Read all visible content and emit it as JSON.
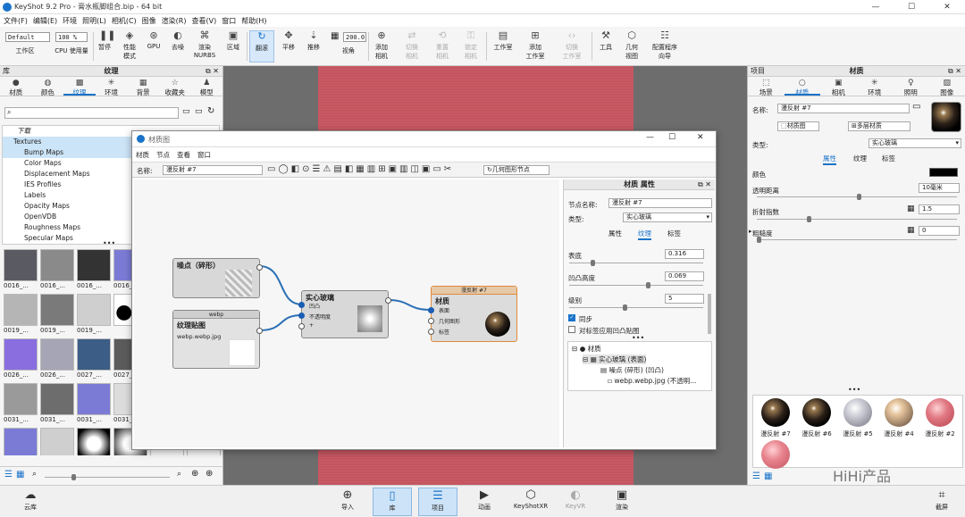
{
  "app": {
    "title": "KeyShot 9.2 Pro - 膏水瓶脚组合.bip - 64 bit",
    "min": "—",
    "max": "☐",
    "close": "✕"
  },
  "menu": [
    "文件(F)",
    "编辑(E)",
    "环境",
    "照明(L)",
    "相机(C)",
    "图像",
    "渲染(R)",
    "查看(V)",
    "窗口",
    "帮助(H)"
  ],
  "toolbar": {
    "workspace_value": "Default",
    "workspace_label": "工作区",
    "cpu_value": "100 %",
    "cpu_label": "CPU 使用量",
    "pause": "暂停",
    "perf": "性能\n模式",
    "gpu": "GPU",
    "denoise": "去噪",
    "nurbs": "渲染\nNURBS",
    "region": "区域",
    "tumble": "翻滚",
    "pan": "平移",
    "dolly": "推移",
    "fov_value": "200.0",
    "view": "视角",
    "add_cam": "添加\n相机",
    "switch_cam": "切换\n相机",
    "reset_cam": "重置\n相机",
    "lock_cam": "锁定\n相机",
    "workspace": "工作室",
    "add_ws": "添加\n工作室",
    "switch_ws": "切换\n工作室",
    "tools": "工具",
    "geo_view": "几何\n视图",
    "config": "配置程序\n向导"
  },
  "library": {
    "title": "库",
    "panel_title": "纹理",
    "tabs": [
      "材质",
      "颜色",
      "纹理",
      "环境",
      "背景",
      "收藏夹",
      "模型"
    ],
    "tree_top": "下载",
    "tree_root": "Textures",
    "tree": [
      "Bump Maps",
      "Color Maps",
      "Displacement Maps",
      "IES Profiles",
      "Labels",
      "Opacity Maps",
      "OpenVDB",
      "Roughness Maps",
      "Specular Maps"
    ],
    "thumbs": [
      "0016_...",
      "0016_...",
      "0016_...",
      "0016_...",
      "",
      "",
      "0019_...",
      "0019_...",
      "0019_...",
      "",
      "",
      "",
      "0026_...",
      "0026_...",
      "0027_...",
      "0027_...",
      "",
      "",
      "0031_...",
      "0031_...",
      "0031_...",
      "0031_...",
      "",
      "",
      "",
      "",
      "",
      "",
      "",
      ""
    ]
  },
  "dialog": {
    "title": "材质图",
    "menu": [
      "材质",
      "节点",
      "查看",
      "窗口"
    ],
    "name_label": "名称:",
    "name_value": "漫反射 #7",
    "geo_node": "几何图形节点",
    "nodes": {
      "noise_title": "噪点（碎形）",
      "webp_header": "webp",
      "webp_title": "纹理贴图",
      "webp_file": "webp.webp.jpg",
      "glass_title": "实心玻璃",
      "glass_p1": "凹凸",
      "glass_p2": "不透明度",
      "glass_p3": "+",
      "mat_header": "漫反射 #7",
      "mat_title": "材质",
      "mat_p1": "表面",
      "mat_p2": "几何图形",
      "mat_p3": "标签"
    },
    "props": {
      "title": "材质 属性",
      "node_name_label": "节点名称:",
      "node_name": "漫反射 #7",
      "type_label": "类型:",
      "type_value": "实心玻璃",
      "tabs": [
        "属性",
        "纹理",
        "标签"
      ],
      "bump_label": "表底",
      "bump_value": "0.316",
      "height_label": "凹凸高度",
      "height_value": "0.069",
      "level_label": "级别",
      "level_value": "5",
      "sync": "同步",
      "apply_label": "对标签应用凹凸贴图",
      "tree": [
        "材质",
        "实心玻璃 (表面)",
        "噪点 (碎形) (凹凸)",
        "webp.webp.jpg (不透明..."
      ]
    }
  },
  "project": {
    "title": "项目",
    "panel_title": "材质",
    "tabs": [
      "场景",
      "材质",
      "相机",
      "环境",
      "照明",
      "图像"
    ],
    "name_label": "名称:",
    "name_value": "漫反射 #7",
    "graph_btn": "材质图",
    "multi_btn": "多层材质",
    "type_label": "类型:",
    "type_value": "实心玻璃",
    "subtabs": [
      "属性",
      "纹理",
      "标签"
    ],
    "color_label": "颜色",
    "trans_label": "透明距离",
    "trans_value": "10毫米",
    "ior_label": "折射指数",
    "ior_value": "1.5",
    "rough_label": "粗糙度",
    "rough_value": "0",
    "swatches": [
      "漫反射 #7",
      "漫反射 #6",
      "漫反射 #5",
      "漫反射 #4",
      "漫反射 #2",
      ""
    ],
    "colors": {
      "accent": "#1a73c9",
      "viewport_pink": "#c5545f",
      "swatch_color": "#000000"
    }
  },
  "bottom": {
    "cloud": "云库",
    "import": "导入",
    "library": "库",
    "project": "项目",
    "animation": "动画",
    "xr": "KeyShotXR",
    "vr": "KeyVR",
    "render": "渲染",
    "screenshot": "截屏",
    "watermark": "HiHi产品"
  }
}
